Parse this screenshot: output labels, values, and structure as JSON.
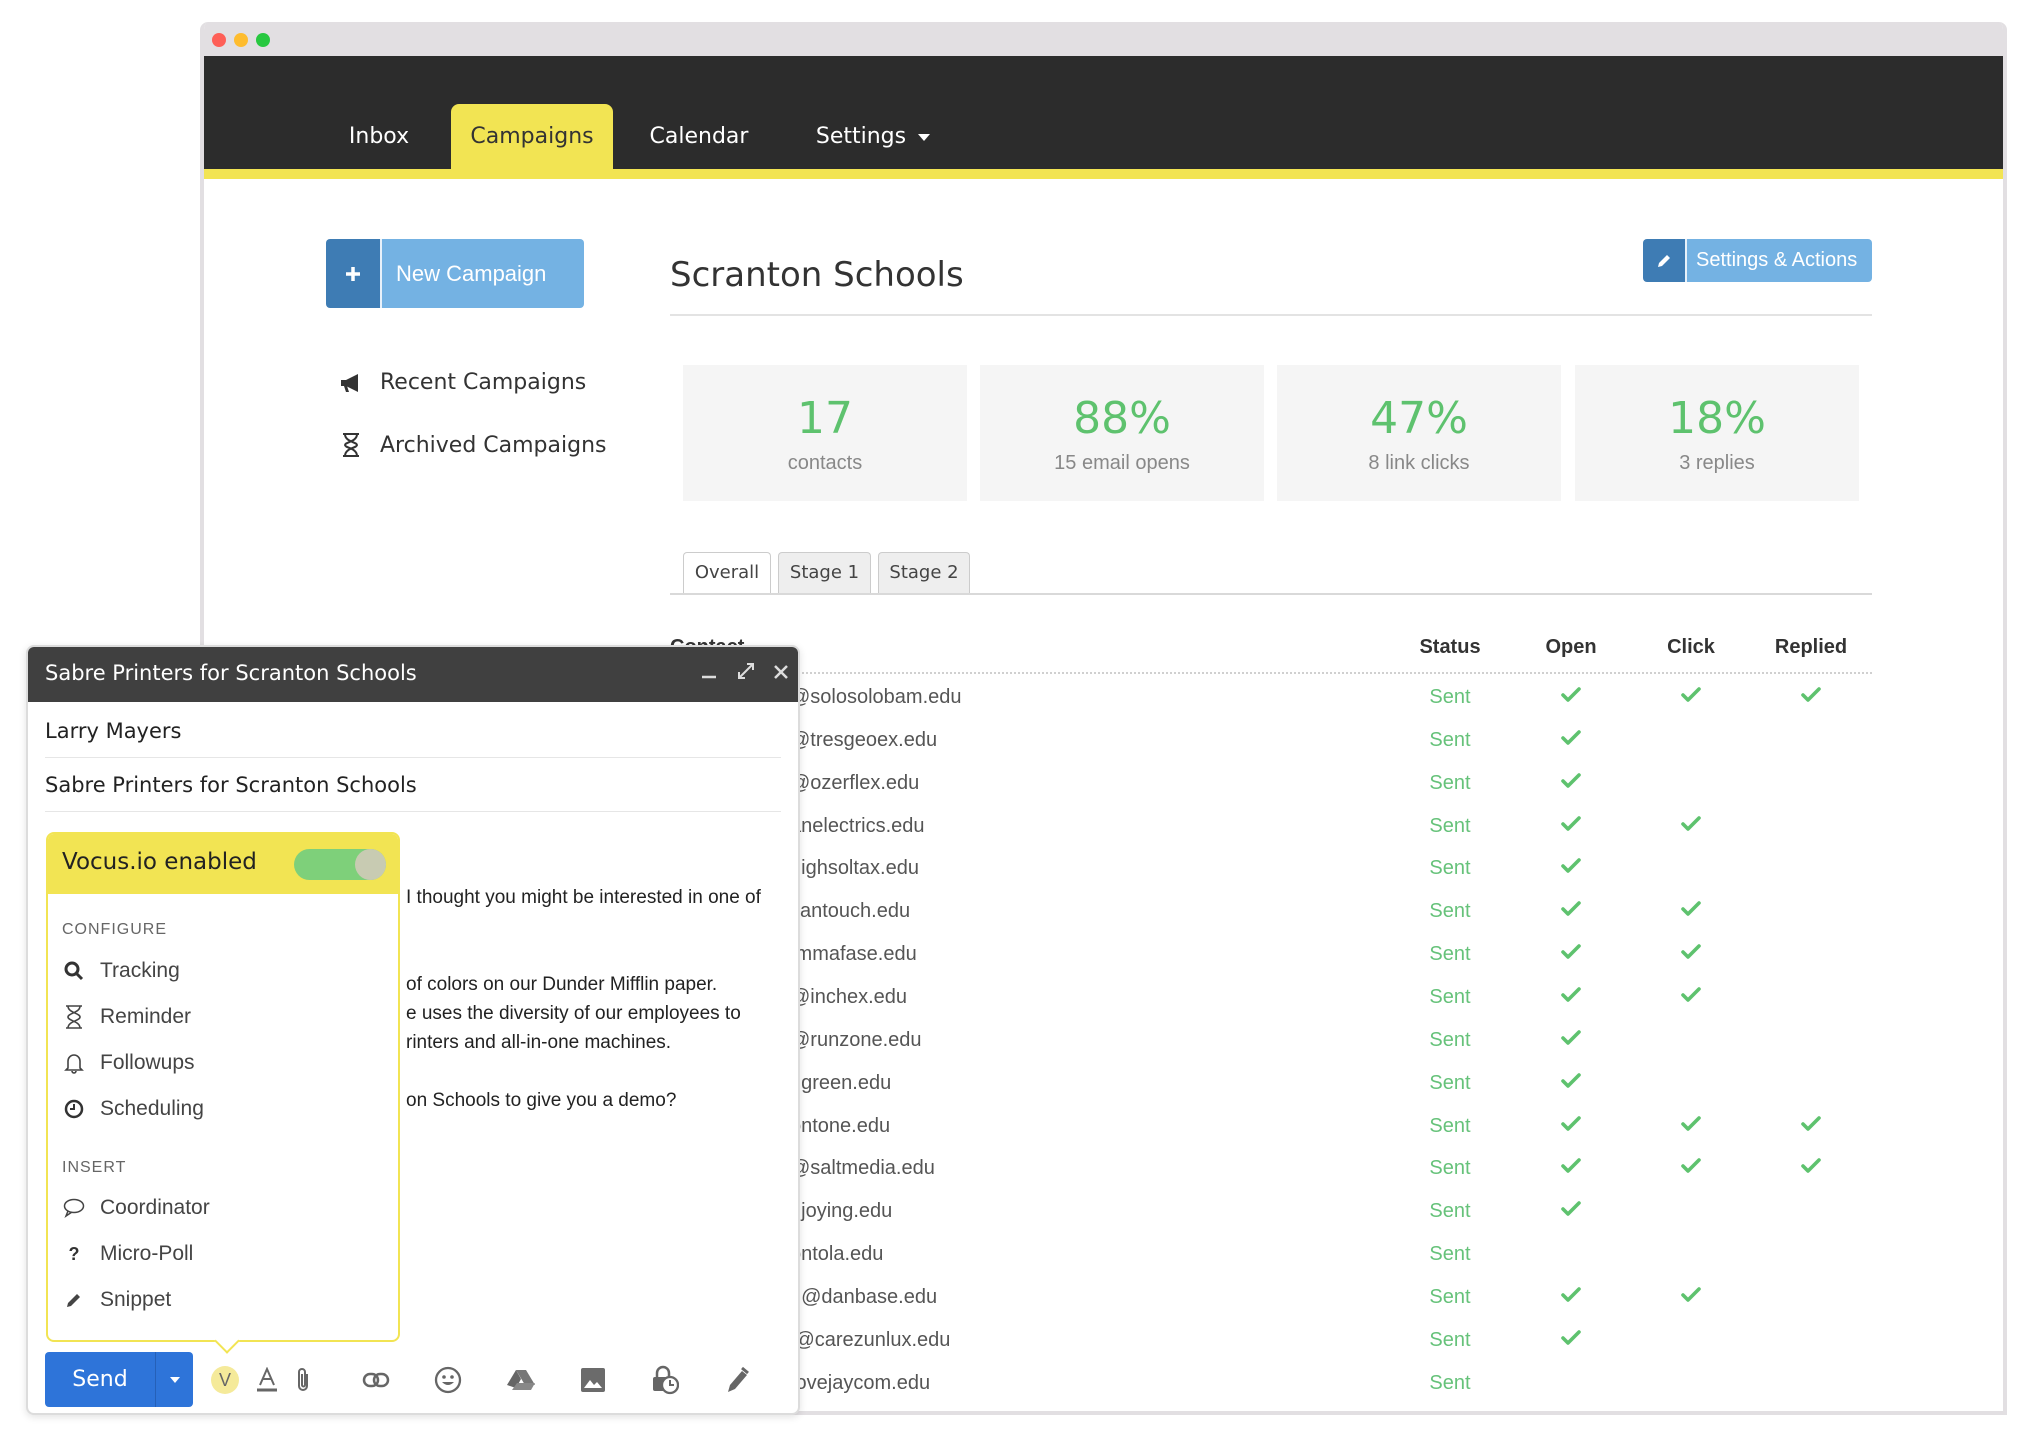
{
  "window": {
    "traffic_lights": {
      "close": "#fe5f57",
      "minimize": "#febc2e",
      "maximize": "#28c840"
    }
  },
  "nav": {
    "tabs": [
      {
        "label": "Inbox",
        "active": false
      },
      {
        "label": "Campaigns",
        "active": true
      },
      {
        "label": "Calendar",
        "active": false
      },
      {
        "label": "Settings",
        "active": false,
        "has_dropdown": true
      }
    ],
    "accent": "#f2e453"
  },
  "sidebar": {
    "new_campaign_label": "New Campaign",
    "new_campaign_icon": "plus-icon",
    "items": [
      {
        "label": "Recent Campaigns",
        "icon": "megaphone-icon"
      },
      {
        "label": "Archived Campaigns",
        "icon": "hourglass-icon"
      }
    ]
  },
  "campaign": {
    "title": "Scranton Schools",
    "settings_button_label": "Settings & Actions",
    "settings_button_icon": "pencil-icon",
    "stats": [
      {
        "value": "17",
        "label": "contacts"
      },
      {
        "value": "88%",
        "label": "15 email opens"
      },
      {
        "value": "47%",
        "label": "8 link clicks"
      },
      {
        "value": "18%",
        "label": "3 replies"
      }
    ],
    "tabs": [
      {
        "label": "Overall",
        "active": true
      },
      {
        "label": "Stage 1",
        "active": false
      },
      {
        "label": "Stage 2",
        "active": false
      }
    ],
    "table": {
      "columns": [
        "Contact",
        "Status",
        "Open",
        "Click",
        "Replied"
      ],
      "rows": [
        {
          "contact": "⁠@solosolobam.edu",
          "status": "Sent",
          "open": true,
          "click": true,
          "replied": true
        },
        {
          "contact": "@tresgeoex.edu",
          "status": "Sent",
          "open": true,
          "click": false,
          "replied": false
        },
        {
          "contact": "@ozerflex.edu",
          "status": "Sent",
          "open": true,
          "click": false,
          "replied": false
        },
        {
          "contact": "anelectrics.edu",
          "status": "Sent",
          "open": true,
          "click": true,
          "replied": false
        },
        {
          "contact": "highsoltax.edu",
          "status": "Sent",
          "open": true,
          "click": false,
          "replied": false
        },
        {
          "contact": "cantouch.edu",
          "status": "Sent",
          "open": true,
          "click": true,
          "replied": false
        },
        {
          "contact": "ımmafase.edu",
          "status": "Sent",
          "open": true,
          "click": true,
          "replied": false
        },
        {
          "contact": "@inchex.edu",
          "status": "Sent",
          "open": true,
          "click": true,
          "replied": false
        },
        {
          "contact": "@runzone.edu",
          "status": "Sent",
          "open": true,
          "click": false,
          "replied": false
        },
        {
          "contact": "ngreen.edu",
          "status": "Sent",
          "open": true,
          "click": false,
          "replied": false
        },
        {
          "contact": "ontone.edu",
          "status": "Sent",
          "open": true,
          "click": true,
          "replied": true
        },
        {
          "contact": "@saltmedia.edu",
          "status": "Sent",
          "open": true,
          "click": true,
          "replied": true
        },
        {
          "contact": "njoying.edu",
          "status": "Sent",
          "open": true,
          "click": false,
          "replied": false
        },
        {
          "contact": "ontola.edu",
          "status": "Sent",
          "open": false,
          "click": false,
          "replied": false
        },
        {
          "contact": "d@danbase.edu",
          "status": "Sent",
          "open": true,
          "click": true,
          "replied": false
        },
        {
          "contact": "l@carezunlux.edu",
          "status": "Sent",
          "open": true,
          "click": false,
          "replied": false
        },
        {
          "contact": "ıovejaycom.edu",
          "status": "Sent",
          "open": false,
          "click": false,
          "replied": false
        }
      ]
    }
  },
  "compose": {
    "title": "Sabre Printers for Scranton Schools",
    "to": "Larry Mayers",
    "subject": "Sabre Printers for Scranton Schools",
    "body_lines": [
      "I thought you might be interested in one of",
      "of colors on our Dunder Mifflin paper.",
      "e uses the diversity of our employees to",
      "rinters and all-in-one machines.",
      "on Schools to give you a demo?"
    ],
    "send_label": "Send",
    "toolbar_icons": [
      "vocus-icon",
      "text-format-icon",
      "attachment-icon",
      "link-icon",
      "emoji-icon",
      "drive-icon",
      "photo-icon",
      "confidential-icon",
      "signature-icon"
    ]
  },
  "vocus": {
    "title": "Vocus.io enabled",
    "enabled": true,
    "configure_heading": "CONFIGURE",
    "configure_items": [
      {
        "label": "Tracking",
        "icon": "search-icon"
      },
      {
        "label": "Reminder",
        "icon": "hourglass-icon"
      },
      {
        "label": "Followups",
        "icon": "bell-icon"
      },
      {
        "label": "Scheduling",
        "icon": "clock-icon"
      }
    ],
    "insert_heading": "INSERT",
    "insert_items": [
      {
        "label": "Coordinator",
        "icon": "speech-bubble-icon"
      },
      {
        "label": "Micro-Poll",
        "icon": "question-icon"
      },
      {
        "label": "Snippet",
        "icon": "pencil-icon"
      }
    ]
  }
}
